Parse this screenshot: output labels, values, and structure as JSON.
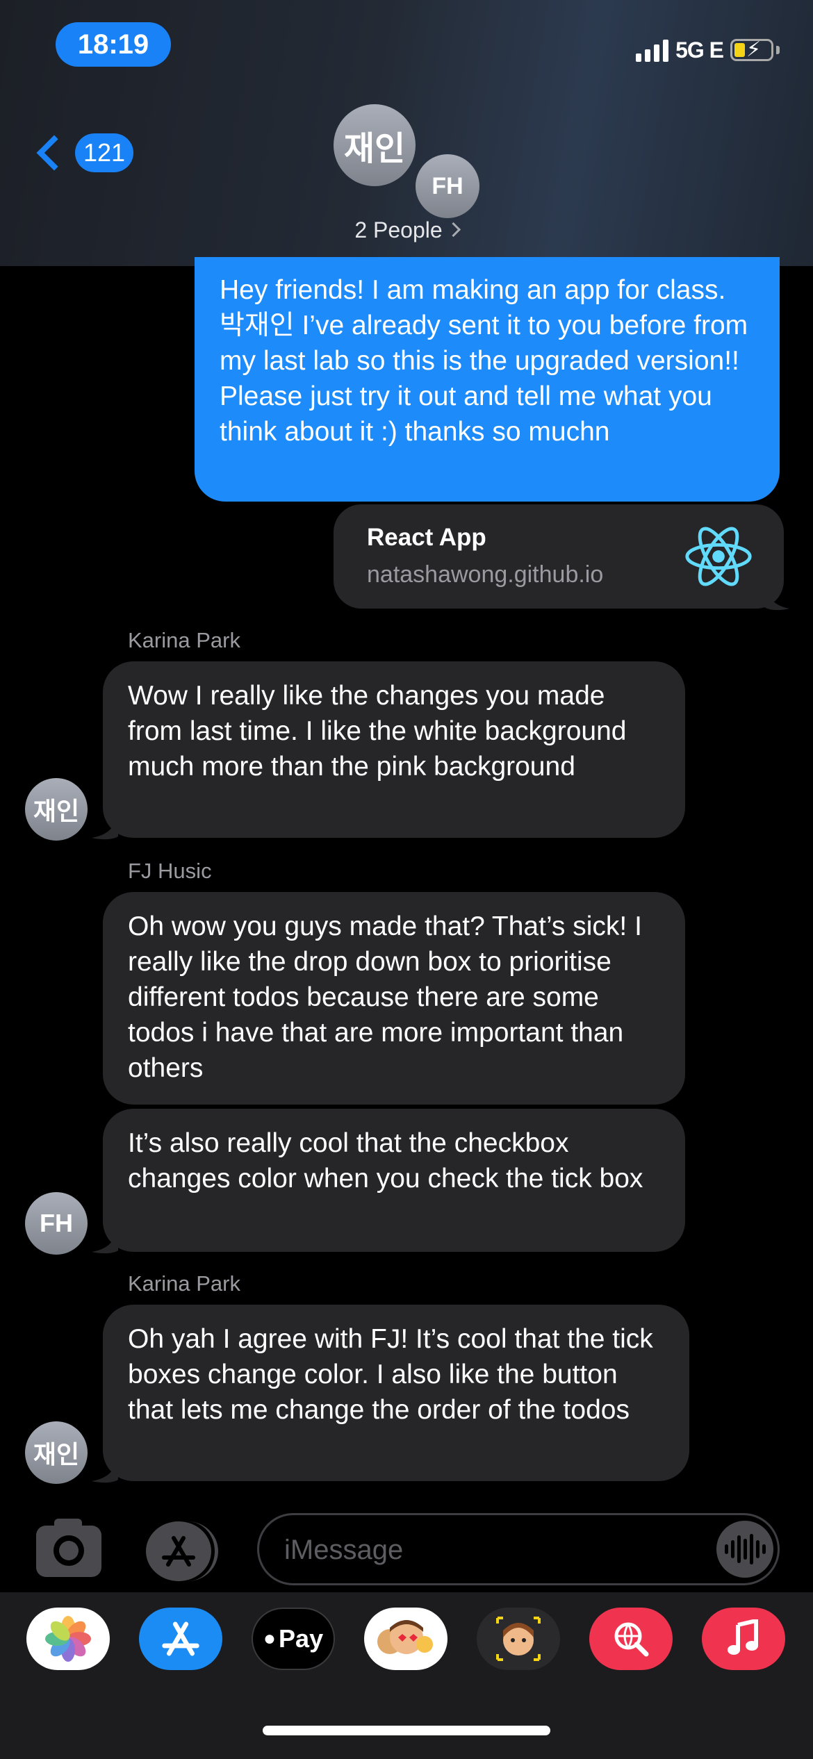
{
  "status_bar": {
    "time": "18:19",
    "network": "5G E"
  },
  "nav": {
    "back_count": "121",
    "people_label": "2 People"
  },
  "participants": [
    {
      "initials": "재인"
    },
    {
      "initials": "FH"
    }
  ],
  "messages": {
    "outgoing_1": "Hey friends! I am making an app for class. 박재인 I’ve already sent it to you before from my last lab so this is the upgraded version!! Please just try it out and tell me what you think about it :) thanks so muchn",
    "link": {
      "title": "React App",
      "url": "natashawong.github.io"
    },
    "karina_1": {
      "sender": "Karina Park",
      "avatar": "재인",
      "text": "Wow I really like the changes you made from last time. I like the white background much more than the pink background"
    },
    "fj_1": {
      "sender": "FJ Husic",
      "text": "Oh wow you guys made that? That’s sick! I really like the drop down box to prioritise different todos because there are some todos i have that are more important than others"
    },
    "fj_2": {
      "avatar": "FH",
      "text": "It’s also really cool that the checkbox changes color when you check the tick box"
    },
    "karina_2": {
      "sender": "Karina Park",
      "avatar": "재인",
      "text": "Oh yah I agree with FJ! It’s cool that the tick boxes change color. I also like the button that lets me change the order of the todos"
    }
  },
  "composer": {
    "placeholder": "iMessage"
  },
  "app_tray": {
    "apple_pay_label": "Pay",
    "items": [
      "photos-icon",
      "app-store-icon",
      "apple-pay-icon",
      "memoji-stickers-icon",
      "memoji-icon",
      "web-search-icon",
      "music-icon"
    ]
  },
  "colors": {
    "accent": "#1a82f7",
    "outgoing_bubble": "#1d8bfa",
    "incoming_bubble": "#262629",
    "background": "#000000"
  }
}
